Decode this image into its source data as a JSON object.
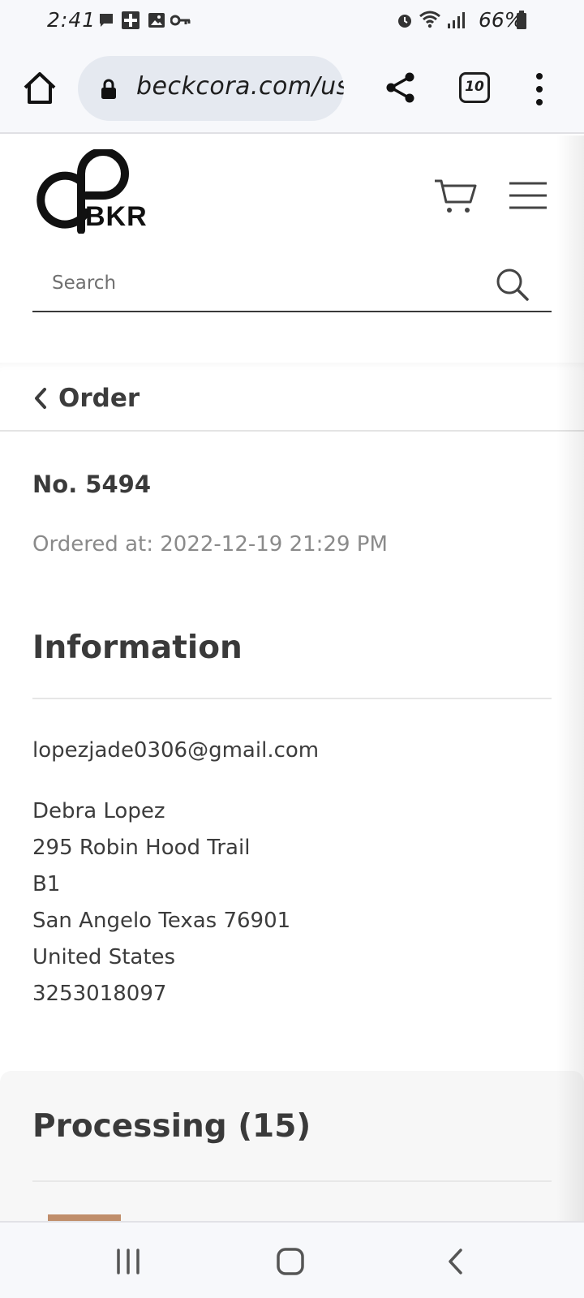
{
  "status_bar": {
    "time": "2:41",
    "battery_percent": "66%"
  },
  "browser": {
    "url": "beckcora.com/us",
    "tab_count": "10"
  },
  "site": {
    "logo_text": "BKR",
    "search_placeholder": "Search"
  },
  "order_header": {
    "title": "Order"
  },
  "order": {
    "number": "No. 5494",
    "ordered_at_label": "Ordered at: ",
    "ordered_at_value": "2022-12-19 21:29 PM"
  },
  "information": {
    "heading": "Information",
    "email": "lopezjade0306@gmail.com",
    "address_lines": [
      "Debra Lopez",
      "295 Robin Hood Trail",
      "B1",
      "San Angelo Texas 76901",
      "United States",
      "3253018097"
    ]
  },
  "processing": {
    "heading": "Processing (15)"
  },
  "colors": {
    "accent_thumbnail": "#c08e6b",
    "text_primary": "#3c3c3c",
    "text_muted": "#8a8a8a"
  },
  "icons": [
    "home-icon",
    "lock-icon",
    "share-icon",
    "tabs-icon",
    "more-vert-icon",
    "cart-icon",
    "hamburger-menu-icon",
    "search-icon",
    "chevron-left-icon",
    "nav-recents-icon",
    "nav-home-icon",
    "nav-back-icon"
  ]
}
